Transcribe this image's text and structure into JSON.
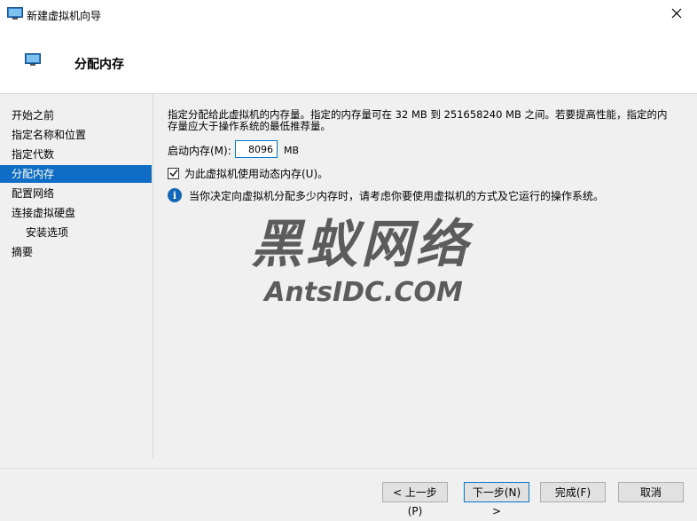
{
  "window": {
    "title": "新建虚拟机向导"
  },
  "header": {
    "title": "分配内存"
  },
  "sidebar": {
    "items": [
      {
        "label": "开始之前"
      },
      {
        "label": "指定名称和位置"
      },
      {
        "label": "指定代数"
      },
      {
        "label": "分配内存"
      },
      {
        "label": "配置网络"
      },
      {
        "label": "连接虚拟硬盘"
      },
      {
        "label": "安装选项"
      },
      {
        "label": "摘要"
      }
    ],
    "active_index": 3
  },
  "main": {
    "description": "指定分配给此虚拟机的内存量。指定的内存量可在 32 MB 到 251658240 MB 之间。若要提高性能，指定的内存量应大于操作系统的最低推荐量。",
    "startup_memory_label": "启动内存(M):",
    "startup_memory_value": "8096",
    "startup_memory_unit": "MB",
    "dynamic_memory_label": "为此虚拟机使用动态内存(U)。",
    "dynamic_memory_checked": true,
    "info_text": "当你决定向虚拟机分配多少内存时，请考虑你要使用虚拟机的方式及它运行的操作系统。"
  },
  "watermark": {
    "line1": "黑蚁网络",
    "line2": "AntsIDC.COM"
  },
  "buttons": {
    "previous": "< 上一步(P)",
    "next": "下一步(N) >",
    "finish": "完成(F)",
    "cancel": "取消"
  },
  "icons": {
    "window": "vm-monitor-icon",
    "header": "vm-monitor-icon",
    "close": "close-icon",
    "info": "info-icon",
    "check": "checkmark-icon"
  },
  "colors": {
    "accent": "#0f6dc6",
    "info": "#1466b8"
  }
}
